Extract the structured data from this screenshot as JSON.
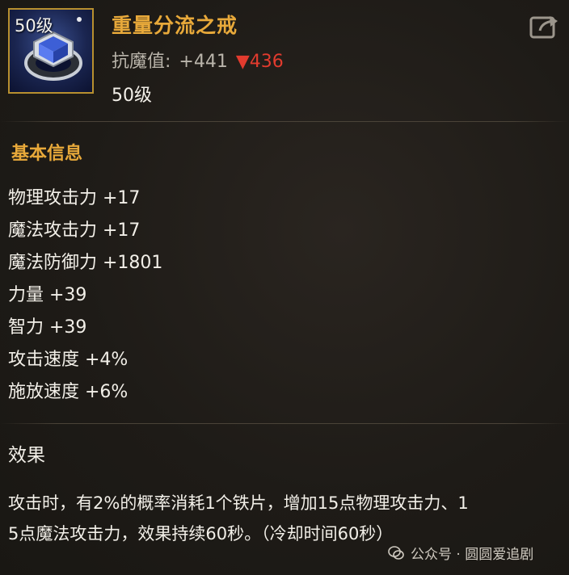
{
  "item": {
    "level_badge": "50级",
    "name": "重量分流之戒",
    "stat_label": "抗魔值:",
    "stat_value": "+441",
    "stat_down_arrow": "▼",
    "stat_down_value": "436",
    "level_text": "50级",
    "icon": "ring-icon",
    "share_icon": "share-icon"
  },
  "basic": {
    "title": "基本信息",
    "attributes": [
      "物理攻击力 +17",
      "魔法攻击力 +17",
      "魔法防御力 +1801",
      "力量 +39",
      "智力 +39",
      "攻击速度 +4%",
      "施放速度 +6%"
    ]
  },
  "effect": {
    "title": "效果",
    "line1": "攻击时，有2%的概率消耗1个铁片，增加15点物理攻击力、1",
    "line2": "5点魔法攻击力，效果持续60秒。（冷却时间60秒）"
  },
  "watermark": {
    "text": "公众号 · 圆圆爱追剧",
    "icon": "wechat-icon"
  },
  "colors": {
    "name_gold": "#e8a93a",
    "down_red": "#e23b2e",
    "frame_gold": "#b8902f"
  }
}
